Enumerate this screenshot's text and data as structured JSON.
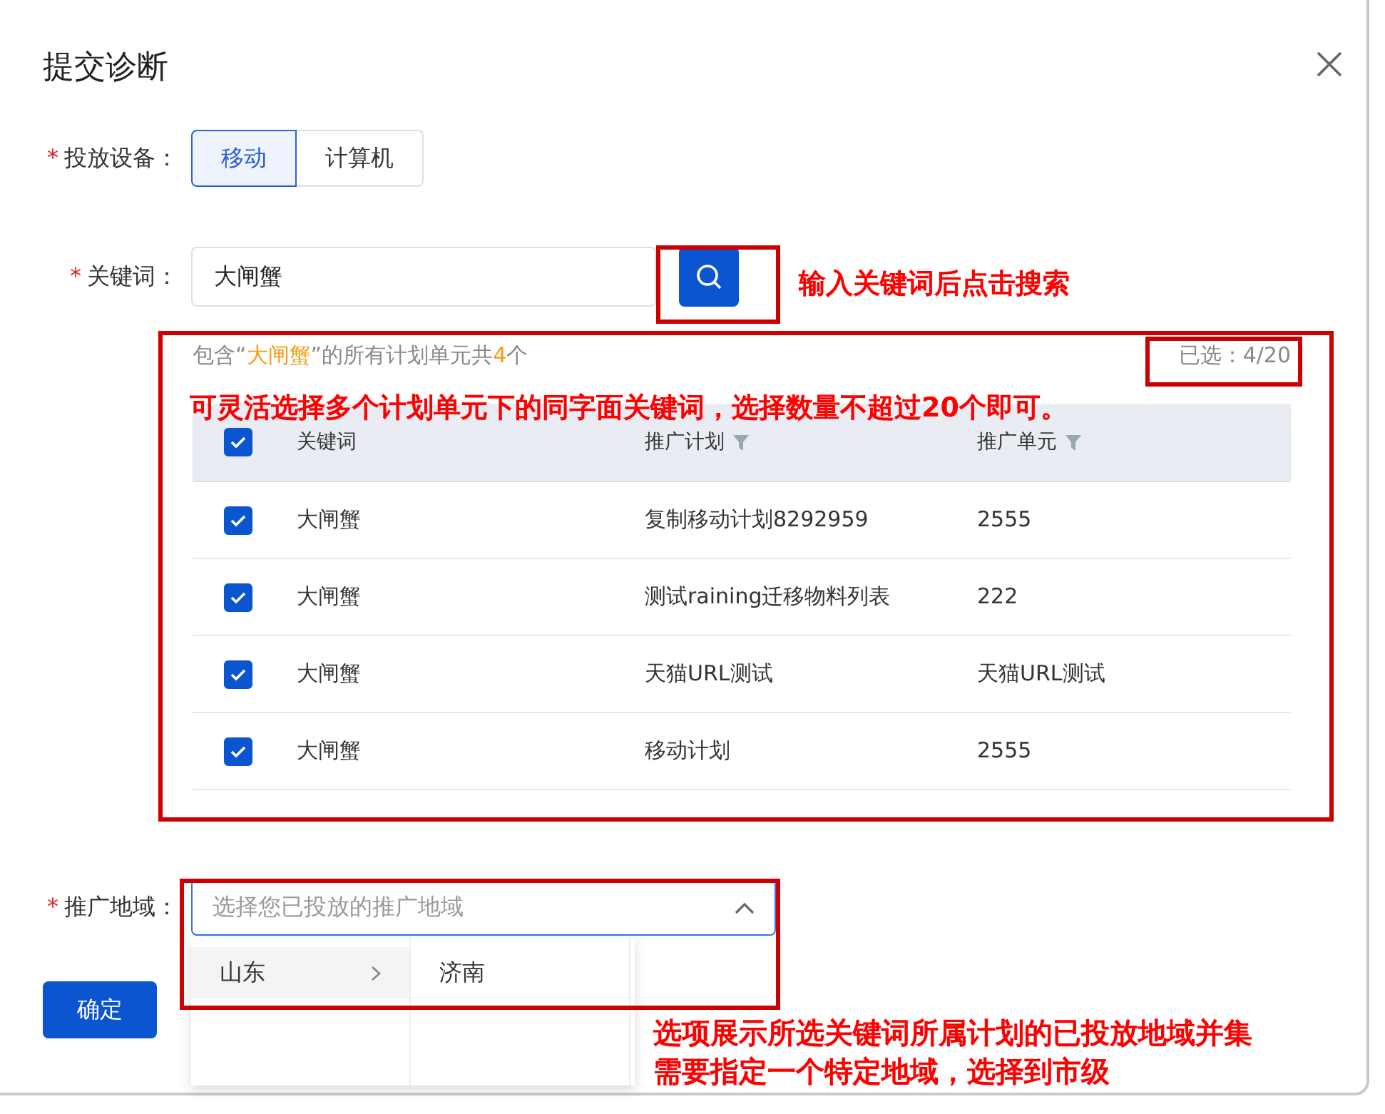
{
  "dialog": {
    "title": "提交诊断"
  },
  "device": {
    "required_mark": "*",
    "label": "投放设备：",
    "options": [
      {
        "label": "移动",
        "selected": true
      },
      {
        "label": "计算机",
        "selected": false
      }
    ]
  },
  "keyword": {
    "required_mark": "*",
    "label": "关键词：",
    "value": "大闸蟹"
  },
  "results": {
    "summary_parts": [
      {
        "text": "包含“",
        "highlight": false
      },
      {
        "text": "大闸蟹",
        "highlight": true
      },
      {
        "text": "”的所有计划单元共",
        "highlight": false
      },
      {
        "text": "4",
        "highlight": true
      },
      {
        "text": "个",
        "highlight": false
      }
    ],
    "selected_count": "已选：4/20",
    "all_checked": true,
    "columns": [
      {
        "label": "关键词",
        "filterable": false
      },
      {
        "label": "推广计划",
        "filterable": true
      },
      {
        "label": "推广单元",
        "filterable": true
      }
    ],
    "rows": [
      {
        "keyword": "大闸蟹",
        "plan": "复制移动计划8292959",
        "unit": "2555",
        "checked": true
      },
      {
        "keyword": "大闸蟹",
        "plan": "测试raining迁移物料列表",
        "unit": "222",
        "checked": true
      },
      {
        "keyword": "大闸蟹",
        "plan": "天猫URL测试",
        "unit": "天猫URL测试",
        "checked": true
      },
      {
        "keyword": "大闸蟹",
        "plan": "移动计划",
        "unit": "2555",
        "checked": true
      }
    ]
  },
  "region": {
    "required_mark": "*",
    "label": "推广地域：",
    "placeholder": "选择您已投放的推广地域",
    "expanded": true,
    "provinces": [
      {
        "label": "山东",
        "selected": true
      }
    ],
    "cities": [
      {
        "label": "济南",
        "selected": false
      }
    ]
  },
  "confirm_button": "确定",
  "annotations": [
    {
      "lines": [
        "输入关键词后点击搜索"
      ]
    },
    {
      "lines": [
        "可灵活选择多个计划单元下的同字面关键词，选择数量不超过20个即可。"
      ]
    },
    {
      "lines": [
        "选项展示所选关键词所属计划的已投放地域并集",
        "需要指定一个特定地域，选择到市级"
      ]
    }
  ]
}
